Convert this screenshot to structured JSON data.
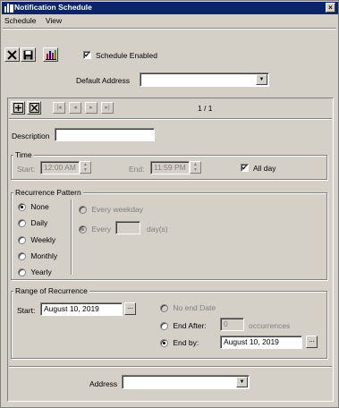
{
  "window": {
    "title": "Notification Schedule",
    "close_glyph": "×"
  },
  "menu": [
    {
      "label": "Schedule"
    },
    {
      "label": "View"
    }
  ],
  "toolbar": {
    "buttons": [
      {
        "icon": "delete-x-icon"
      },
      {
        "icon": "save-disk-icon"
      },
      {
        "icon": "bar-chart-icon"
      }
    ],
    "schedule_enabled_label": "Schedule Enabled",
    "schedule_enabled": true
  },
  "default_address": {
    "label": "Default Address",
    "value": ""
  },
  "record_nav": {
    "position_text": "1 / 1",
    "first_glyph": "|◂",
    "prev_glyph": "◂",
    "next_glyph": "▸",
    "last_glyph": "▸|"
  },
  "description": {
    "label": "Description",
    "value": ""
  },
  "time": {
    "legend": "Time",
    "start_label": "Start:",
    "start_value": "12:00 AM",
    "end_label": "End:",
    "end_value": "11:59 PM",
    "all_day_label": "All day",
    "all_day": true
  },
  "recurrence": {
    "legend": "Recurrence Pattern",
    "options": [
      {
        "label": "None",
        "selected": true
      },
      {
        "label": "Daily",
        "selected": false
      },
      {
        "label": "Weekly",
        "selected": false
      },
      {
        "label": "Monthly",
        "selected": false
      },
      {
        "label": "Yearly",
        "selected": false
      }
    ],
    "every_weekday_label": "Every weekday",
    "every_label": "Every",
    "every_value": "",
    "days_label": "day(s)"
  },
  "range": {
    "legend": "Range of Recurrence",
    "start_label": "Start:",
    "start_value": "August 10, 2019",
    "no_end_label": "No end Date",
    "end_after_label": "End After:",
    "end_after_value": "0",
    "occurrences_label": "occurrences",
    "end_by_label": "End by:",
    "end_by_value": "August 10, 2019",
    "ellipsis": "..."
  },
  "address": {
    "label": "Address",
    "value": ""
  },
  "colors": {
    "title_bar": "#0a246a",
    "face": "#d4d0c8",
    "chart_bars": [
      "#cc0000",
      "#0000cc",
      "#008800"
    ]
  }
}
